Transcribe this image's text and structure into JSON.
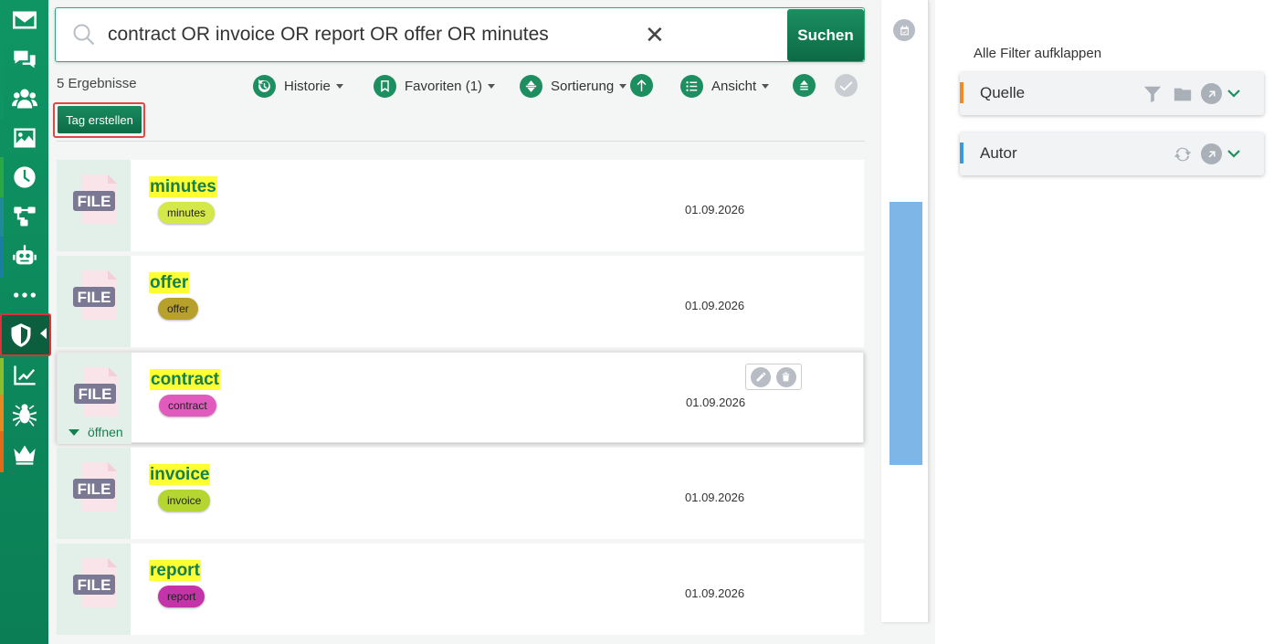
{
  "sidebar": {
    "items": [
      {
        "name": "mail-icon"
      },
      {
        "name": "chat-icon"
      },
      {
        "name": "users-icon"
      },
      {
        "name": "image-icon"
      },
      {
        "name": "clock-icon"
      },
      {
        "name": "workflow-icon"
      },
      {
        "name": "robot-icon"
      },
      {
        "name": "more-icon"
      },
      {
        "name": "shield-icon",
        "active": true
      },
      {
        "name": "chart-icon"
      },
      {
        "name": "bug-icon"
      },
      {
        "name": "crown-icon"
      }
    ]
  },
  "search": {
    "query": "contract OR invoice OR report OR offer OR minutes",
    "button_label": "Suchen",
    "clear_symbol": "✕"
  },
  "results": {
    "count_label": "5 Ergebnisse"
  },
  "toolbar": {
    "history_label": "Historie",
    "favorites_label": "Favoriten (1)",
    "sort_label": "Sortierung",
    "view_label": "Ansicht"
  },
  "tag_button_label": "Tag erstellen",
  "cards": [
    {
      "title": "minutes",
      "tag": "minutes",
      "tag_color": "#d4e84a",
      "date": "01.09.2026"
    },
    {
      "title": "offer",
      "tag": "offer",
      "tag_color": "#b7a02c",
      "date": "01.09.2026"
    },
    {
      "title": "contract",
      "tag": "contract",
      "tag_color": "#e05bbd",
      "date": "01.09.2026",
      "open_label": "öffnen"
    },
    {
      "title": "invoice",
      "tag": "invoice",
      "tag_color": "#b5d631",
      "date": "01.09.2026"
    },
    {
      "title": "report",
      "tag": "report",
      "tag_color": "#c234a8",
      "date": "01.09.2026"
    }
  ],
  "thumbnail_label": "FILE",
  "filters": {
    "expand_all_label": "Alle Filter aufklappen",
    "items": [
      {
        "label": "Quelle",
        "accent": "#f08a24"
      },
      {
        "label": "Autor",
        "accent": "#3a9ad9"
      }
    ]
  },
  "colors": {
    "brand": "#0f9564",
    "highlight": "#ffff33",
    "scroll_thumb": "#7fb6e8"
  }
}
